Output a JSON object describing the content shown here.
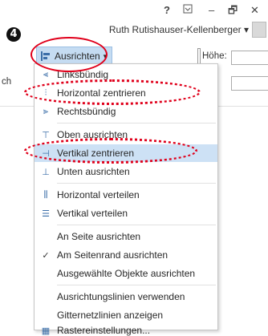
{
  "window": {
    "help": "?",
    "restore_icon": "ribbon-display-icon",
    "minimize": "–",
    "maximize": "🗗",
    "close": "✕"
  },
  "step_number": "4",
  "user": {
    "name": "Ruth Rutishauser-Kellenberger",
    "dropdown": "▾"
  },
  "ribbon": {
    "align_button": {
      "label": "Ausrichten",
      "arrow": "▾"
    },
    "height_label": "Höhe:",
    "left_partial": "ch"
  },
  "menu": {
    "items": [
      {
        "label": "Linksbündig",
        "icon": "align-left-icon",
        "glyph": "⫷"
      },
      {
        "label": "Horizontal zentrieren",
        "icon": "align-center-icon",
        "glyph": "⫶"
      },
      {
        "label": "Rechtsbündig",
        "icon": "align-right-icon",
        "glyph": "⫸"
      },
      {
        "label": "Oben ausrichten",
        "icon": "align-top-icon",
        "glyph": "⊤"
      },
      {
        "label": "Vertikal zentrieren",
        "icon": "align-middle-icon",
        "glyph": "⊣"
      },
      {
        "label": "Unten ausrichten",
        "icon": "align-bottom-icon",
        "glyph": "⊥"
      },
      {
        "label": "Horizontal verteilen",
        "icon": "distribute-horizontal-icon",
        "glyph": "⫼"
      },
      {
        "label": "Vertikal verteilen",
        "icon": "distribute-vertical-icon",
        "glyph": "☰"
      },
      {
        "label": "An Seite ausrichten",
        "icon": "",
        "glyph": ""
      },
      {
        "label": "Am Seitenrand ausrichten",
        "icon": "checkmark-icon",
        "glyph": "✓"
      },
      {
        "label": "Ausgewählte Objekte ausrichten",
        "icon": "",
        "glyph": ""
      },
      {
        "label": "Ausrichtungslinien verwenden",
        "icon": "",
        "glyph": ""
      },
      {
        "label": "Gitternetzlinien anzeigen",
        "icon": "",
        "glyph": ""
      },
      {
        "label": "Rastereinstellungen...",
        "icon": "grid-icon",
        "glyph": "▦"
      }
    ]
  },
  "colors": {
    "accent": "#e0001b",
    "highlight": "#cde1f5"
  }
}
